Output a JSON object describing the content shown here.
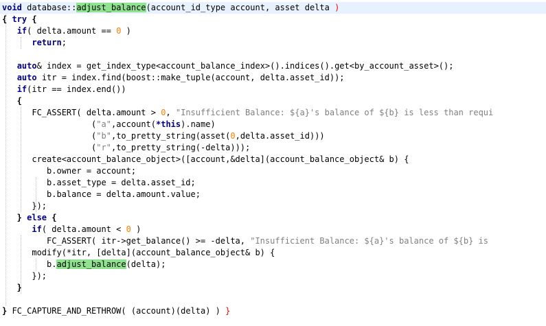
{
  "editor": {
    "lines": [
      {
        "id": 1,
        "segments": [
          {
            "t": "void",
            "c": "kw"
          },
          {
            "t": " database::",
            "c": ""
          },
          {
            "t": "adjust_balance",
            "c": "hl"
          },
          {
            "t": "(",
            "c": ""
          },
          {
            "t": "account_id_type account, asset delta ",
            "c": ""
          },
          {
            "t": ")",
            "c": "brace-match"
          }
        ]
      },
      {
        "id": 2,
        "segments": [
          {
            "t": "{ ",
            "c": "brace"
          },
          {
            "t": "try",
            "c": "kw"
          },
          {
            "t": " {",
            "c": "brace"
          }
        ]
      },
      {
        "id": 3,
        "segments": [
          {
            "t": "   ",
            "c": ""
          },
          {
            "t": "if",
            "c": "kw"
          },
          {
            "t": "( delta.amount == ",
            "c": ""
          },
          {
            "t": "0",
            "c": "num"
          },
          {
            "t": " )",
            "c": ""
          }
        ]
      },
      {
        "id": 4,
        "segments": [
          {
            "t": "      ",
            "c": ""
          },
          {
            "t": "return",
            "c": "kw"
          },
          {
            "t": ";",
            "c": ""
          }
        ]
      },
      {
        "id": 5,
        "segments": []
      },
      {
        "id": 6,
        "segments": [
          {
            "t": "   ",
            "c": ""
          },
          {
            "t": "auto",
            "c": "kw"
          },
          {
            "t": "& index = get_index_type<account_balance_index>().indices().get<by_account_asset>();",
            "c": ""
          }
        ]
      },
      {
        "id": 7,
        "segments": [
          {
            "t": "   ",
            "c": ""
          },
          {
            "t": "auto",
            "c": "kw"
          },
          {
            "t": " itr = index.find(boost::make_tuple(account, delta.asset_id));",
            "c": ""
          }
        ]
      },
      {
        "id": 8,
        "segments": [
          {
            "t": "   ",
            "c": ""
          },
          {
            "t": "if",
            "c": "kw"
          },
          {
            "t": "(itr == index.end())",
            "c": ""
          }
        ]
      },
      {
        "id": 9,
        "segments": [
          {
            "t": "   {",
            "c": "brace"
          }
        ]
      },
      {
        "id": 10,
        "segments": [
          {
            "t": "      FC_ASSERT( delta.amount > ",
            "c": ""
          },
          {
            "t": "0",
            "c": "num"
          },
          {
            "t": ", ",
            "c": ""
          },
          {
            "t": "\"Insufficient Balance: ${a}'s balance of ${b} is less than requi",
            "c": "str"
          }
        ]
      },
      {
        "id": 11,
        "segments": [
          {
            "t": "                  (",
            "c": ""
          },
          {
            "t": "\"a\"",
            "c": "str"
          },
          {
            "t": ",account(",
            "c": ""
          },
          {
            "t": "*this",
            "c": "kw"
          },
          {
            "t": ").name)",
            "c": ""
          }
        ]
      },
      {
        "id": 12,
        "segments": [
          {
            "t": "                  (",
            "c": ""
          },
          {
            "t": "\"b\"",
            "c": "str"
          },
          {
            "t": ",to_pretty_string(asset(",
            "c": ""
          },
          {
            "t": "0",
            "c": "num"
          },
          {
            "t": ",delta.asset_id)))",
            "c": ""
          }
        ]
      },
      {
        "id": 13,
        "segments": [
          {
            "t": "                  (",
            "c": ""
          },
          {
            "t": "\"r\"",
            "c": "str"
          },
          {
            "t": ",to_pretty_string(-delta)));",
            "c": ""
          }
        ]
      },
      {
        "id": 14,
        "segments": [
          {
            "t": "      create<account_balance_object>([account,&delta](account_balance_object& b) {",
            "c": ""
          }
        ]
      },
      {
        "id": 15,
        "segments": [
          {
            "t": "         b.owner = account;",
            "c": ""
          }
        ]
      },
      {
        "id": 16,
        "segments": [
          {
            "t": "         b.asset_type = delta.asset_id;",
            "c": ""
          }
        ]
      },
      {
        "id": 17,
        "segments": [
          {
            "t": "         b.balance = delta.amount.value;",
            "c": ""
          }
        ]
      },
      {
        "id": 18,
        "segments": [
          {
            "t": "      });",
            "c": ""
          }
        ]
      },
      {
        "id": 19,
        "segments": [
          {
            "t": "   } ",
            "c": "brace"
          },
          {
            "t": "else",
            "c": "kw"
          },
          {
            "t": " {",
            "c": "brace"
          }
        ]
      },
      {
        "id": 20,
        "segments": [
          {
            "t": "      ",
            "c": ""
          },
          {
            "t": "if",
            "c": "kw"
          },
          {
            "t": "( delta.amount < ",
            "c": ""
          },
          {
            "t": "0",
            "c": "num"
          },
          {
            "t": " )",
            "c": ""
          }
        ]
      },
      {
        "id": 21,
        "segments": [
          {
            "t": "         FC_ASSERT( itr->get_balance() >= -delta, ",
            "c": ""
          },
          {
            "t": "\"Insufficient Balance: ${a}'s balance of ${b} is",
            "c": "str"
          }
        ]
      },
      {
        "id": 22,
        "segments": [
          {
            "t": "      modify(*itr, [delta](account_balance_object& b) {",
            "c": ""
          }
        ]
      },
      {
        "id": 23,
        "segments": [
          {
            "t": "         b.",
            "c": ""
          },
          {
            "t": "adjust_balance",
            "c": "hl"
          },
          {
            "t": "(delta);",
            "c": ""
          }
        ]
      },
      {
        "id": 24,
        "segments": [
          {
            "t": "      });",
            "c": ""
          }
        ]
      },
      {
        "id": 25,
        "segments": [
          {
            "t": "   }",
            "c": "brace"
          }
        ]
      },
      {
        "id": 26,
        "segments": []
      },
      {
        "id": 27,
        "segments": [
          {
            "t": "} ",
            "c": "brace"
          },
          {
            "t": "FC_CAPTURE_AND_RETHROW( (account)(delta) ) ",
            "c": ""
          },
          {
            "t": "}",
            "c": "brace-match"
          }
        ]
      }
    ]
  }
}
